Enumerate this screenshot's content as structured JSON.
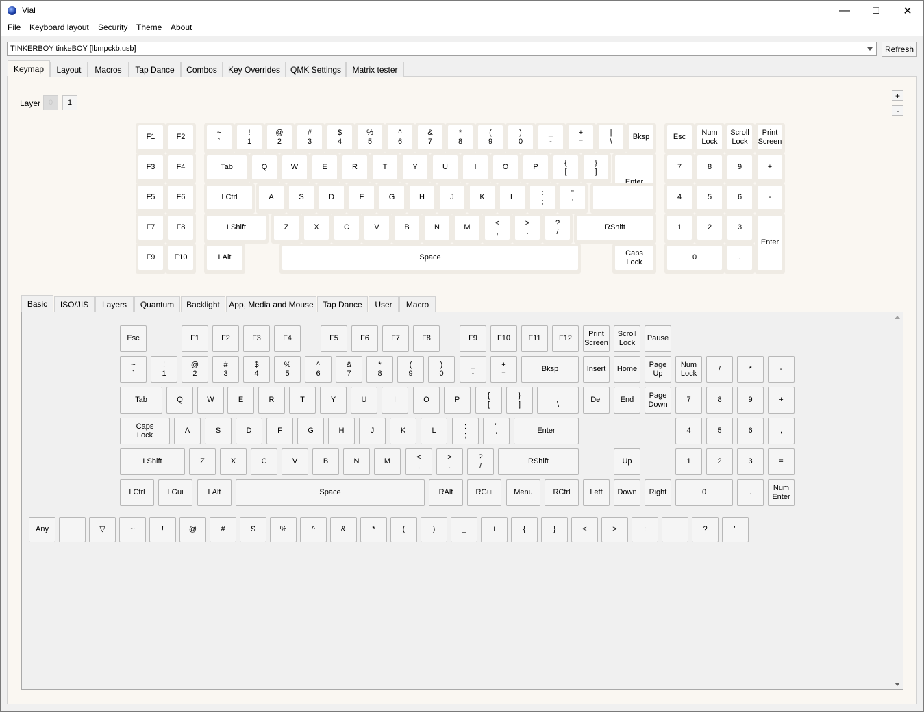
{
  "window": {
    "title": "Vial",
    "minimize": "—",
    "maximize": "☐",
    "close": "✕"
  },
  "menu": [
    "File",
    "Keyboard layout",
    "Security",
    "Theme",
    "About"
  ],
  "device": {
    "selected": "TINKERBOY tinkeBOY [lbmpckb.usb]",
    "refresh_label": "Refresh"
  },
  "main_tabs": [
    "Keymap",
    "Layout",
    "Macros",
    "Tap Dance",
    "Combos",
    "Key Overrides",
    "QMK Settings",
    "Matrix tester"
  ],
  "active_main_tab": "Keymap",
  "layer": {
    "label": "Layer",
    "items": [
      "0",
      "1"
    ],
    "selected": "0",
    "add": "+",
    "remove": "-"
  },
  "keymap_rows": [
    [
      "F1",
      "F2",
      "~\n`",
      "!\n1",
      "@\n2",
      "#\n3",
      "$\n4",
      "%\n5",
      "^\n6",
      "&\n7",
      "*\n8",
      "(\n9",
      ")\n0",
      "_\n-",
      "+\n=",
      "|\n\\",
      "Bksp",
      "Esc",
      "Num\nLock",
      "Scroll\nLock",
      "Print\nScreen"
    ],
    [
      "F3",
      "F4",
      "Tab",
      "Q",
      "W",
      "E",
      "R",
      "T",
      "Y",
      "U",
      "I",
      "O",
      "P",
      "{\n[",
      "}\n]",
      "Enter",
      "7",
      "8",
      "9",
      "+"
    ],
    [
      "F5",
      "F6",
      "LCtrl",
      "A",
      "S",
      "D",
      "F",
      "G",
      "H",
      "J",
      "K",
      "L",
      ":\n;",
      "\"\n'",
      "4",
      "5",
      "6",
      "-"
    ],
    [
      "F7",
      "F8",
      "LShift",
      "Z",
      "X",
      "C",
      "V",
      "B",
      "N",
      "M",
      "<\n,",
      ">\n.",
      "?\n/",
      "RShift",
      "1",
      "2",
      "3",
      "Enter"
    ],
    [
      "F9",
      "F10",
      "LAlt",
      "Space",
      "Caps\nLock",
      "0",
      "."
    ]
  ],
  "key_tabs": [
    "Basic",
    "ISO/JIS",
    "Layers",
    "Quantum",
    "Backlight",
    "App, Media and Mouse",
    "Tap Dance",
    "User",
    "Macro"
  ],
  "active_key_tab": "Basic",
  "basic_rows": [
    [
      "Esc",
      "F1",
      "F2",
      "F3",
      "F4",
      "F5",
      "F6",
      "F7",
      "F8",
      "F9",
      "F10",
      "F11",
      "F12",
      "Print\nScreen",
      "Scroll\nLock",
      "Pause"
    ],
    [
      "~\n`",
      "!\n1",
      "@\n2",
      "#\n3",
      "$\n4",
      "%\n5",
      "^\n6",
      "&\n7",
      "*\n8",
      "(\n9",
      ")\n0",
      "_\n-",
      "+\n=",
      "Bksp",
      "Insert",
      "Home",
      "Page\nUp",
      "Num\nLock",
      "/",
      "*",
      "-"
    ],
    [
      "Tab",
      "Q",
      "W",
      "E",
      "R",
      "T",
      "Y",
      "U",
      "I",
      "O",
      "P",
      "{\n[",
      "}\n]",
      "|\n\\",
      "Del",
      "End",
      "Page\nDown",
      "7",
      "8",
      "9",
      "+"
    ],
    [
      "Caps\nLock",
      "A",
      "S",
      "D",
      "F",
      "G",
      "H",
      "J",
      "K",
      "L",
      ":\n;",
      "\"\n'",
      "Enter",
      "4",
      "5",
      "6",
      ","
    ],
    [
      "LShift",
      "Z",
      "X",
      "C",
      "V",
      "B",
      "N",
      "M",
      "<\n,",
      ">\n.",
      "?\n/",
      "RShift",
      "Up",
      "1",
      "2",
      "3",
      "="
    ],
    [
      "LCtrl",
      "LGui",
      "LAlt",
      "Space",
      "RAlt",
      "RGui",
      "Menu",
      "RCtrl",
      "Left",
      "Down",
      "Right",
      "0",
      ".",
      "Num\nEnter"
    ]
  ],
  "extra_row": [
    "Any",
    "",
    "▽",
    "~",
    "!",
    "@",
    "#",
    "$",
    "%",
    "^",
    "&",
    "*",
    "(",
    ")",
    "_",
    "+",
    "{",
    "}",
    "<",
    ">",
    ":",
    "|",
    "?",
    "\""
  ]
}
